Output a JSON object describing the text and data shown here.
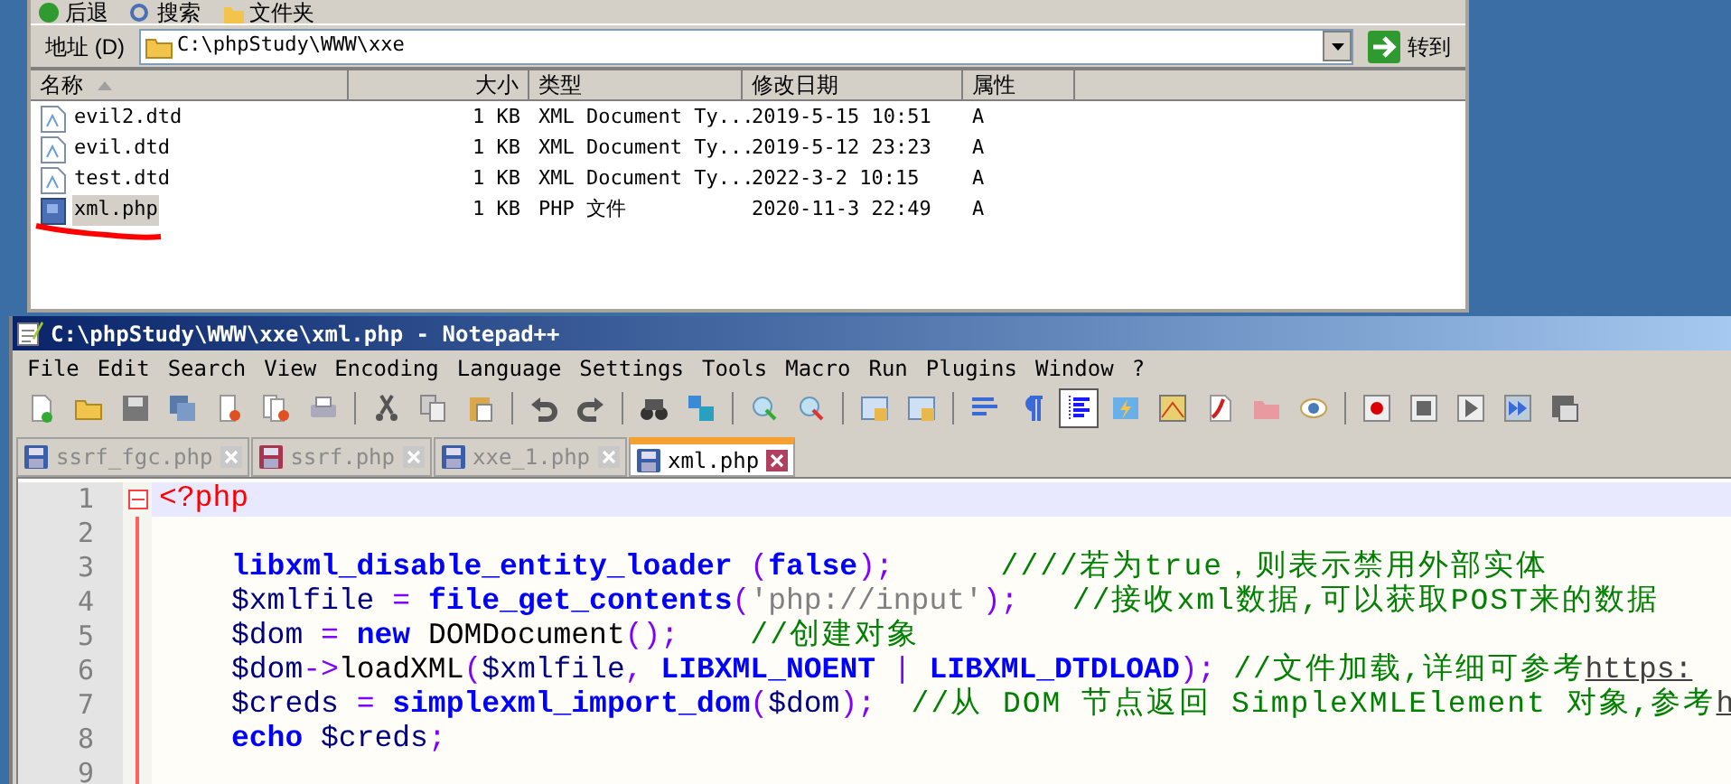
{
  "explorer": {
    "toolbar": [
      "后退",
      "搜索",
      "文件夹"
    ],
    "address": {
      "label": "地址 (D)",
      "value": "C:\\phpStudy\\WWW\\xxe",
      "go": "转到"
    },
    "columns": [
      {
        "label": "名称",
        "sorted": true
      },
      {
        "label": "大小",
        "sorted": false
      },
      {
        "label": "类型",
        "sorted": false
      },
      {
        "label": "修改日期",
        "sorted": false
      },
      {
        "label": "属性",
        "sorted": false
      }
    ],
    "files": [
      {
        "kind": "dtd",
        "name": "evil2.dtd",
        "size": "1 KB",
        "type": "XML Document Ty...",
        "modified": "2019-5-15 10:51",
        "attr": "A",
        "selected": false
      },
      {
        "kind": "dtd",
        "name": "evil.dtd",
        "size": "1 KB",
        "type": "XML Document Ty...",
        "modified": "2019-5-12 23:23",
        "attr": "A",
        "selected": false
      },
      {
        "kind": "dtd",
        "name": "test.dtd",
        "size": "1 KB",
        "type": "XML Document Ty...",
        "modified": "2022-3-2 10:15",
        "attr": "A",
        "selected": false
      },
      {
        "kind": "php",
        "name": "xml.php",
        "size": "1 KB",
        "type": "PHP 文件",
        "modified": "2020-11-3 22:49",
        "attr": "A",
        "selected": true
      }
    ]
  },
  "editor": {
    "title": "C:\\phpStudy\\WWW\\xxe\\xml.php - Notepad++",
    "menu": [
      "File",
      "Edit",
      "Search",
      "View",
      "Encoding",
      "Language",
      "Settings",
      "Tools",
      "Macro",
      "Run",
      "Plugins",
      "Window",
      "?"
    ],
    "toolbar": [
      {
        "kind": "new",
        "selected": false
      },
      {
        "kind": "open",
        "selected": false
      },
      {
        "kind": "save",
        "selected": false
      },
      {
        "kind": "saveall",
        "selected": false
      },
      {
        "kind": "close",
        "selected": false
      },
      {
        "kind": "closeall",
        "selected": false
      },
      {
        "kind": "print",
        "selected": false
      },
      {
        "kind": "sep"
      },
      {
        "kind": "cut",
        "selected": false
      },
      {
        "kind": "copy",
        "selected": false
      },
      {
        "kind": "paste",
        "selected": false
      },
      {
        "kind": "sep"
      },
      {
        "kind": "undo",
        "selected": false
      },
      {
        "kind": "redo",
        "selected": false
      },
      {
        "kind": "sep"
      },
      {
        "kind": "find",
        "selected": false
      },
      {
        "kind": "replace",
        "selected": false
      },
      {
        "kind": "sep"
      },
      {
        "kind": "zoomin",
        "selected": false
      },
      {
        "kind": "zoomout",
        "selected": false
      },
      {
        "kind": "sep"
      },
      {
        "kind": "sync",
        "selected": false
      },
      {
        "kind": "sync",
        "selected": false
      },
      {
        "kind": "sep"
      },
      {
        "kind": "wrap",
        "selected": false
      },
      {
        "kind": "pilcrow",
        "selected": false
      },
      {
        "kind": "indent",
        "selected": true
      },
      {
        "kind": "lang",
        "selected": false
      },
      {
        "kind": "map",
        "selected": false
      },
      {
        "kind": "pdf",
        "selected": false
      },
      {
        "kind": "folder",
        "selected": false
      },
      {
        "kind": "eye",
        "selected": false
      },
      {
        "kind": "sep"
      },
      {
        "kind": "record",
        "selected": false
      },
      {
        "kind": "stop",
        "selected": false
      },
      {
        "kind": "play",
        "selected": false
      },
      {
        "kind": "playmany",
        "selected": false
      },
      {
        "kind": "savemacro",
        "selected": false
      }
    ],
    "tabs": [
      {
        "label": "ssrf_fgc.php",
        "color": "#3b5ea8",
        "selected": false
      },
      {
        "label": "ssrf.php",
        "color": "#a8344f",
        "selected": false
      },
      {
        "label": "xxe_1.php",
        "color": "#3b5ea8",
        "selected": false
      },
      {
        "label": "xml.php",
        "color": "#3b5ea8",
        "selected": true
      }
    ],
    "lines": [
      {
        "number": "1",
        "current": true,
        "fold": true,
        "tokens": [
          {
            "kind": "tag",
            "text": "<?php"
          }
        ]
      },
      {
        "number": "2",
        "current": false,
        "fold": false
      },
      {
        "number": "3",
        "current": false,
        "fold": false,
        "indent": true,
        "tokens": [
          {
            "kind": "keyword",
            "text": "libxml_disable_entity_loader "
          },
          {
            "kind": "op",
            "text": "("
          },
          {
            "kind": "keyword",
            "text": "false"
          },
          {
            "kind": "op",
            "text": ");      "
          },
          {
            "kind": "comment",
            "text": "////若为true，则表示禁用外部实体"
          }
        ]
      },
      {
        "number": "4",
        "current": false,
        "fold": false,
        "indent": true,
        "tokens": [
          {
            "kind": "var",
            "text": "$xmlfile "
          },
          {
            "kind": "op",
            "text": "= "
          },
          {
            "kind": "keyword",
            "text": "file_get_contents"
          },
          {
            "kind": "op",
            "text": "("
          },
          {
            "kind": "string",
            "text": "'php://input'"
          },
          {
            "kind": "op",
            "text": ");   "
          },
          {
            "kind": "comment",
            "text": "//接收xml数据,可以获取POST来的数据"
          }
        ]
      },
      {
        "number": "5",
        "current": false,
        "fold": false,
        "indent": true,
        "tokens": [
          {
            "kind": "var",
            "text": "$dom "
          },
          {
            "kind": "op",
            "text": "= "
          },
          {
            "kind": "keyword",
            "text": "new "
          },
          {
            "kind": "plain",
            "text": "DOMDocument"
          },
          {
            "kind": "op",
            "text": "();    "
          },
          {
            "kind": "comment",
            "text": "//创建对象"
          }
        ]
      },
      {
        "number": "6",
        "current": false,
        "fold": false,
        "indent": true,
        "tokens": [
          {
            "kind": "var",
            "text": "$dom"
          },
          {
            "kind": "op",
            "text": "->"
          },
          {
            "kind": "plain",
            "text": "loadXML"
          },
          {
            "kind": "op",
            "text": "("
          },
          {
            "kind": "var",
            "text": "$xmlfile"
          },
          {
            "kind": "op",
            "text": ", "
          },
          {
            "kind": "keyword",
            "text": "LIBXML_NOENT "
          },
          {
            "kind": "op",
            "text": "| "
          },
          {
            "kind": "keyword",
            "text": "LIBXML_DTDLOAD"
          },
          {
            "kind": "op",
            "text": "); "
          },
          {
            "kind": "comment",
            "text": "//文件加载,详细可参考"
          },
          {
            "kind": "link",
            "text": "https:"
          }
        ]
      },
      {
        "number": "7",
        "current": false,
        "fold": false,
        "indent": true,
        "tokens": [
          {
            "kind": "var",
            "text": "$creds "
          },
          {
            "kind": "op",
            "text": "= "
          },
          {
            "kind": "keyword",
            "text": "simplexml_import_dom"
          },
          {
            "kind": "op",
            "text": "("
          },
          {
            "kind": "var",
            "text": "$dom"
          },
          {
            "kind": "op",
            "text": ");  "
          },
          {
            "kind": "comment",
            "text": "//从 DOM 节点返回 SimpleXMLElement 对象,参考"
          },
          {
            "kind": "link",
            "text": "h"
          }
        ]
      },
      {
        "number": "8",
        "current": false,
        "fold": false,
        "indent": true,
        "tokens": [
          {
            "kind": "keyword",
            "text": "echo "
          },
          {
            "kind": "var",
            "text": "$creds"
          },
          {
            "kind": "op",
            "text": ";"
          }
        ]
      },
      {
        "number": "9",
        "current": false,
        "fold": false
      }
    ]
  }
}
